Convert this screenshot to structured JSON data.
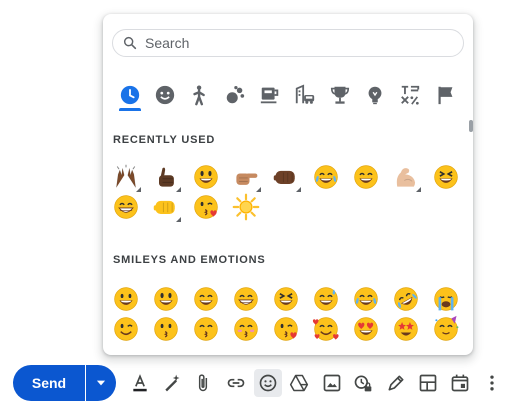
{
  "search": {
    "placeholder": "Search"
  },
  "categories": [
    {
      "id": "recent",
      "icon": "clock-icon",
      "active": true
    },
    {
      "id": "smileys",
      "icon": "smiley-face-icon"
    },
    {
      "id": "people",
      "icon": "person-icon"
    },
    {
      "id": "animals",
      "icon": "animals-nature-icon"
    },
    {
      "id": "food",
      "icon": "food-drink-icon"
    },
    {
      "id": "travel",
      "icon": "travel-places-icon"
    },
    {
      "id": "activities",
      "icon": "trophy-icon"
    },
    {
      "id": "objects",
      "icon": "lightbulb-icon"
    },
    {
      "id": "symbols",
      "icon": "symbols-icon"
    },
    {
      "id": "flags",
      "icon": "flag-icon"
    }
  ],
  "sections": {
    "recent_title": "RECENTLY USED",
    "smileys_title": "SMILEYS AND EMOTIONS"
  },
  "recent_emojis": [
    {
      "name": "raising-hands-dark-emoji",
      "skin_tone_variants": true
    },
    {
      "name": "thumbs-up-dark-emoji",
      "skin_tone_variants": true
    },
    {
      "name": "grinning-face-big-eyes-emoji"
    },
    {
      "name": "pointing-right-medium-emoji",
      "skin_tone_variants": true
    },
    {
      "name": "fist-bump-dark-emoji",
      "skin_tone_variants": true
    },
    {
      "name": "face-tears-of-joy-emoji"
    },
    {
      "name": "grinning-smiling-eyes-emoji"
    },
    {
      "name": "flexed-biceps-light-emoji",
      "skin_tone_variants": true
    },
    {
      "name": "squinting-face-emoji"
    },
    {
      "name": "beaming-face-emoji"
    },
    {
      "name": "fist-bump-yellow-emoji",
      "skin_tone_variants": true
    },
    {
      "name": "face-blowing-kiss-emoji"
    },
    {
      "name": "sun-emoji"
    }
  ],
  "smiley_emojis": [
    {
      "name": "grinning-face-emoji"
    },
    {
      "name": "grinning-face-big-eyes-emoji"
    },
    {
      "name": "grinning-smiling-eyes-emoji"
    },
    {
      "name": "beaming-face-emoji"
    },
    {
      "name": "squinting-face-emoji"
    },
    {
      "name": "grinning-sweat-emoji"
    },
    {
      "name": "face-tears-of-joy-emoji"
    },
    {
      "name": "rolling-laughing-emoji"
    },
    {
      "name": "loudly-crying-emoji"
    },
    {
      "name": "winking-face-emoji"
    },
    {
      "name": "kissing-face-emoji"
    },
    {
      "name": "kissing-smiling-eyes-emoji"
    },
    {
      "name": "kissing-closed-eyes-emoji"
    },
    {
      "name": "face-blowing-kiss-emoji"
    },
    {
      "name": "smiling-hearts-emoji"
    },
    {
      "name": "heart-eyes-emoji"
    },
    {
      "name": "star-struck-emoji"
    },
    {
      "name": "partying-face-emoji"
    }
  ],
  "compose": {
    "send_label": "Send",
    "send_color": "#0b57d0",
    "tools": [
      {
        "icon": "text-format-icon"
      },
      {
        "icon": "magic-pen-icon"
      },
      {
        "icon": "attach-icon"
      },
      {
        "icon": "link-icon"
      },
      {
        "icon": "emoji-icon",
        "active": true
      },
      {
        "icon": "google-drive-icon"
      },
      {
        "icon": "insert-photo-icon"
      },
      {
        "icon": "confidential-mode-icon"
      },
      {
        "icon": "signature-icon"
      },
      {
        "icon": "layouts-icon"
      },
      {
        "icon": "schedule-event-icon"
      },
      {
        "icon": "more-options-icon"
      }
    ]
  },
  "colors": {
    "accent": "#1a73e8",
    "icon_gray": "#5f6368",
    "emoji_yellow": "#fcc21b"
  }
}
